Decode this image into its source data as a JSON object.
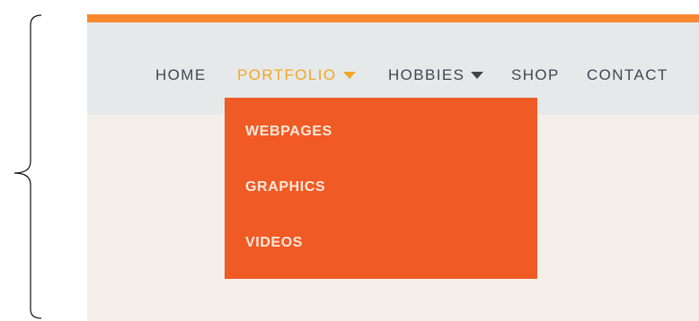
{
  "nav": {
    "items": [
      {
        "label": "HOME"
      },
      {
        "label": "PORTFOLIO"
      },
      {
        "label": "HOBBIES"
      },
      {
        "label": "SHOP"
      },
      {
        "label": "CONTACT"
      }
    ],
    "active_index": 1
  },
  "dropdown": {
    "items": [
      {
        "label": "WEBPAGES"
      },
      {
        "label": "GRAPHICS"
      },
      {
        "label": "VIDEOS"
      }
    ]
  },
  "colors": {
    "accent_stripe": "#f7882f",
    "active_text": "#f2a623",
    "dropdown_bg": "#f05a24",
    "navbar_bg": "#e6e9ea",
    "page_bg": "#f4f0e9",
    "nav_text": "#3f474d"
  },
  "icons": {
    "caret": "chevron-down-icon",
    "brace": "curly-brace"
  }
}
